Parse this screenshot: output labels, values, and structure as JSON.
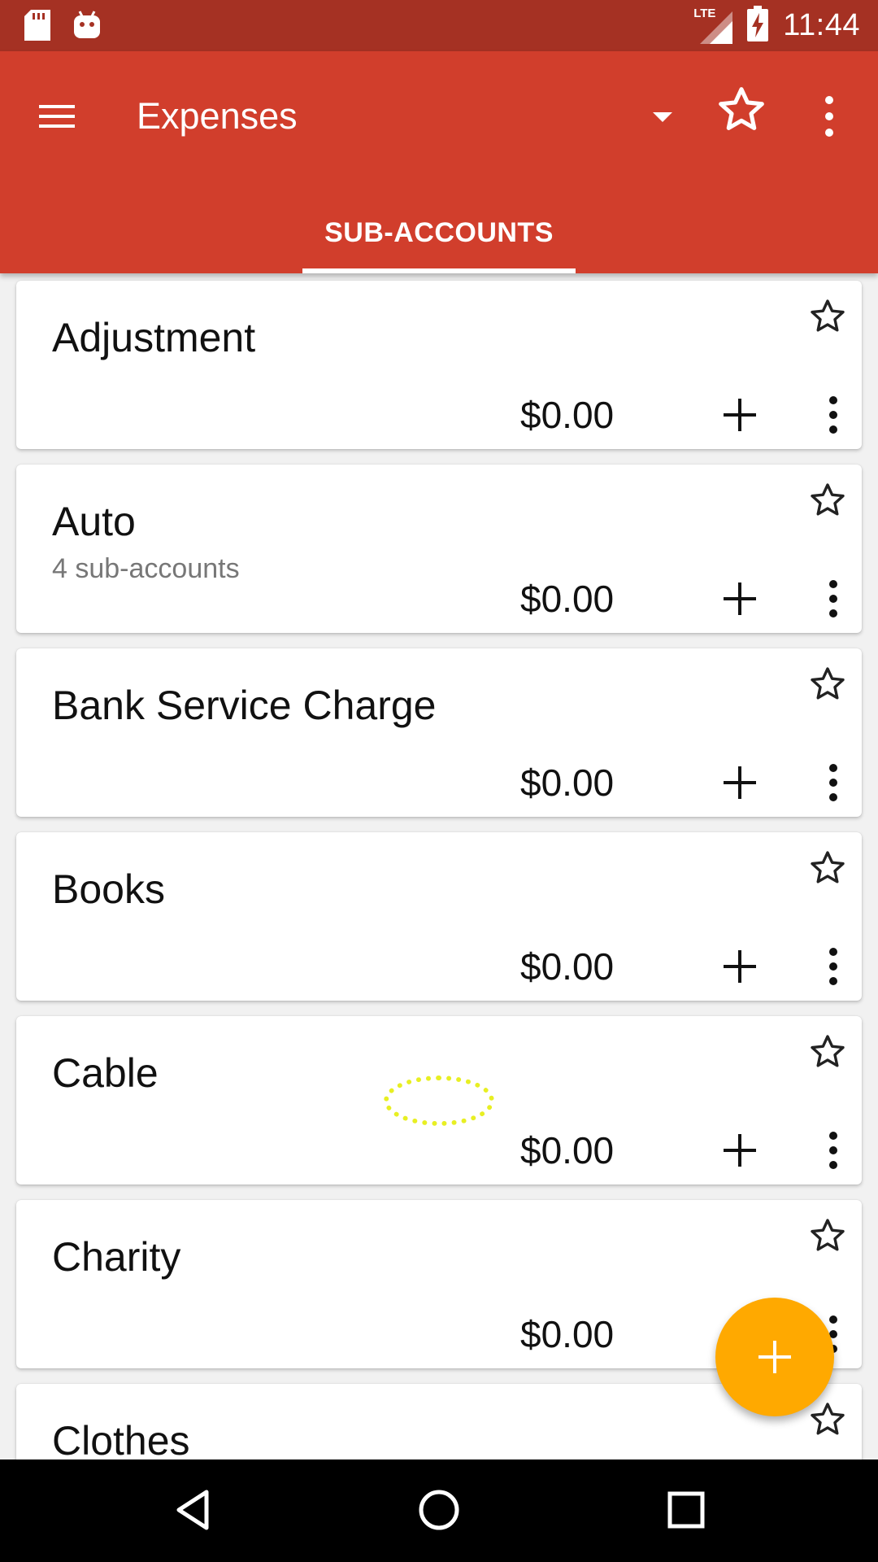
{
  "status_bar": {
    "time": "11:44",
    "network": "LTE",
    "icons": [
      "sd-card-icon",
      "android-icon",
      "signal-icon",
      "battery-charging-icon"
    ]
  },
  "app_bar": {
    "title": "Expenses",
    "tab_label": "SUB-ACCOUNTS",
    "icons": [
      "menu-icon",
      "dropdown-arrow-icon",
      "star-outline-icon",
      "more-vert-icon"
    ]
  },
  "accounts": [
    {
      "name": "Adjustment",
      "subtitle": "",
      "amount": "$0.00"
    },
    {
      "name": "Auto",
      "subtitle": "4 sub-accounts",
      "amount": "$0.00"
    },
    {
      "name": "Bank Service Charge",
      "subtitle": "",
      "amount": "$0.00"
    },
    {
      "name": "Books",
      "subtitle": "",
      "amount": "$0.00"
    },
    {
      "name": "Cable",
      "subtitle": "",
      "amount": "$0.00"
    },
    {
      "name": "Charity",
      "subtitle": "",
      "amount": "$0.00"
    },
    {
      "name": "Clothes",
      "subtitle": "",
      "amount": ""
    }
  ],
  "fab": {
    "icon": "add-icon"
  },
  "nav_bar": {
    "icons": [
      "back-icon",
      "home-icon",
      "recents-icon"
    ]
  },
  "colors": {
    "status_bar": "#a53123",
    "app_bar": "#d13e2c",
    "fab": "#ffa900",
    "background": "#f1f1f1"
  }
}
